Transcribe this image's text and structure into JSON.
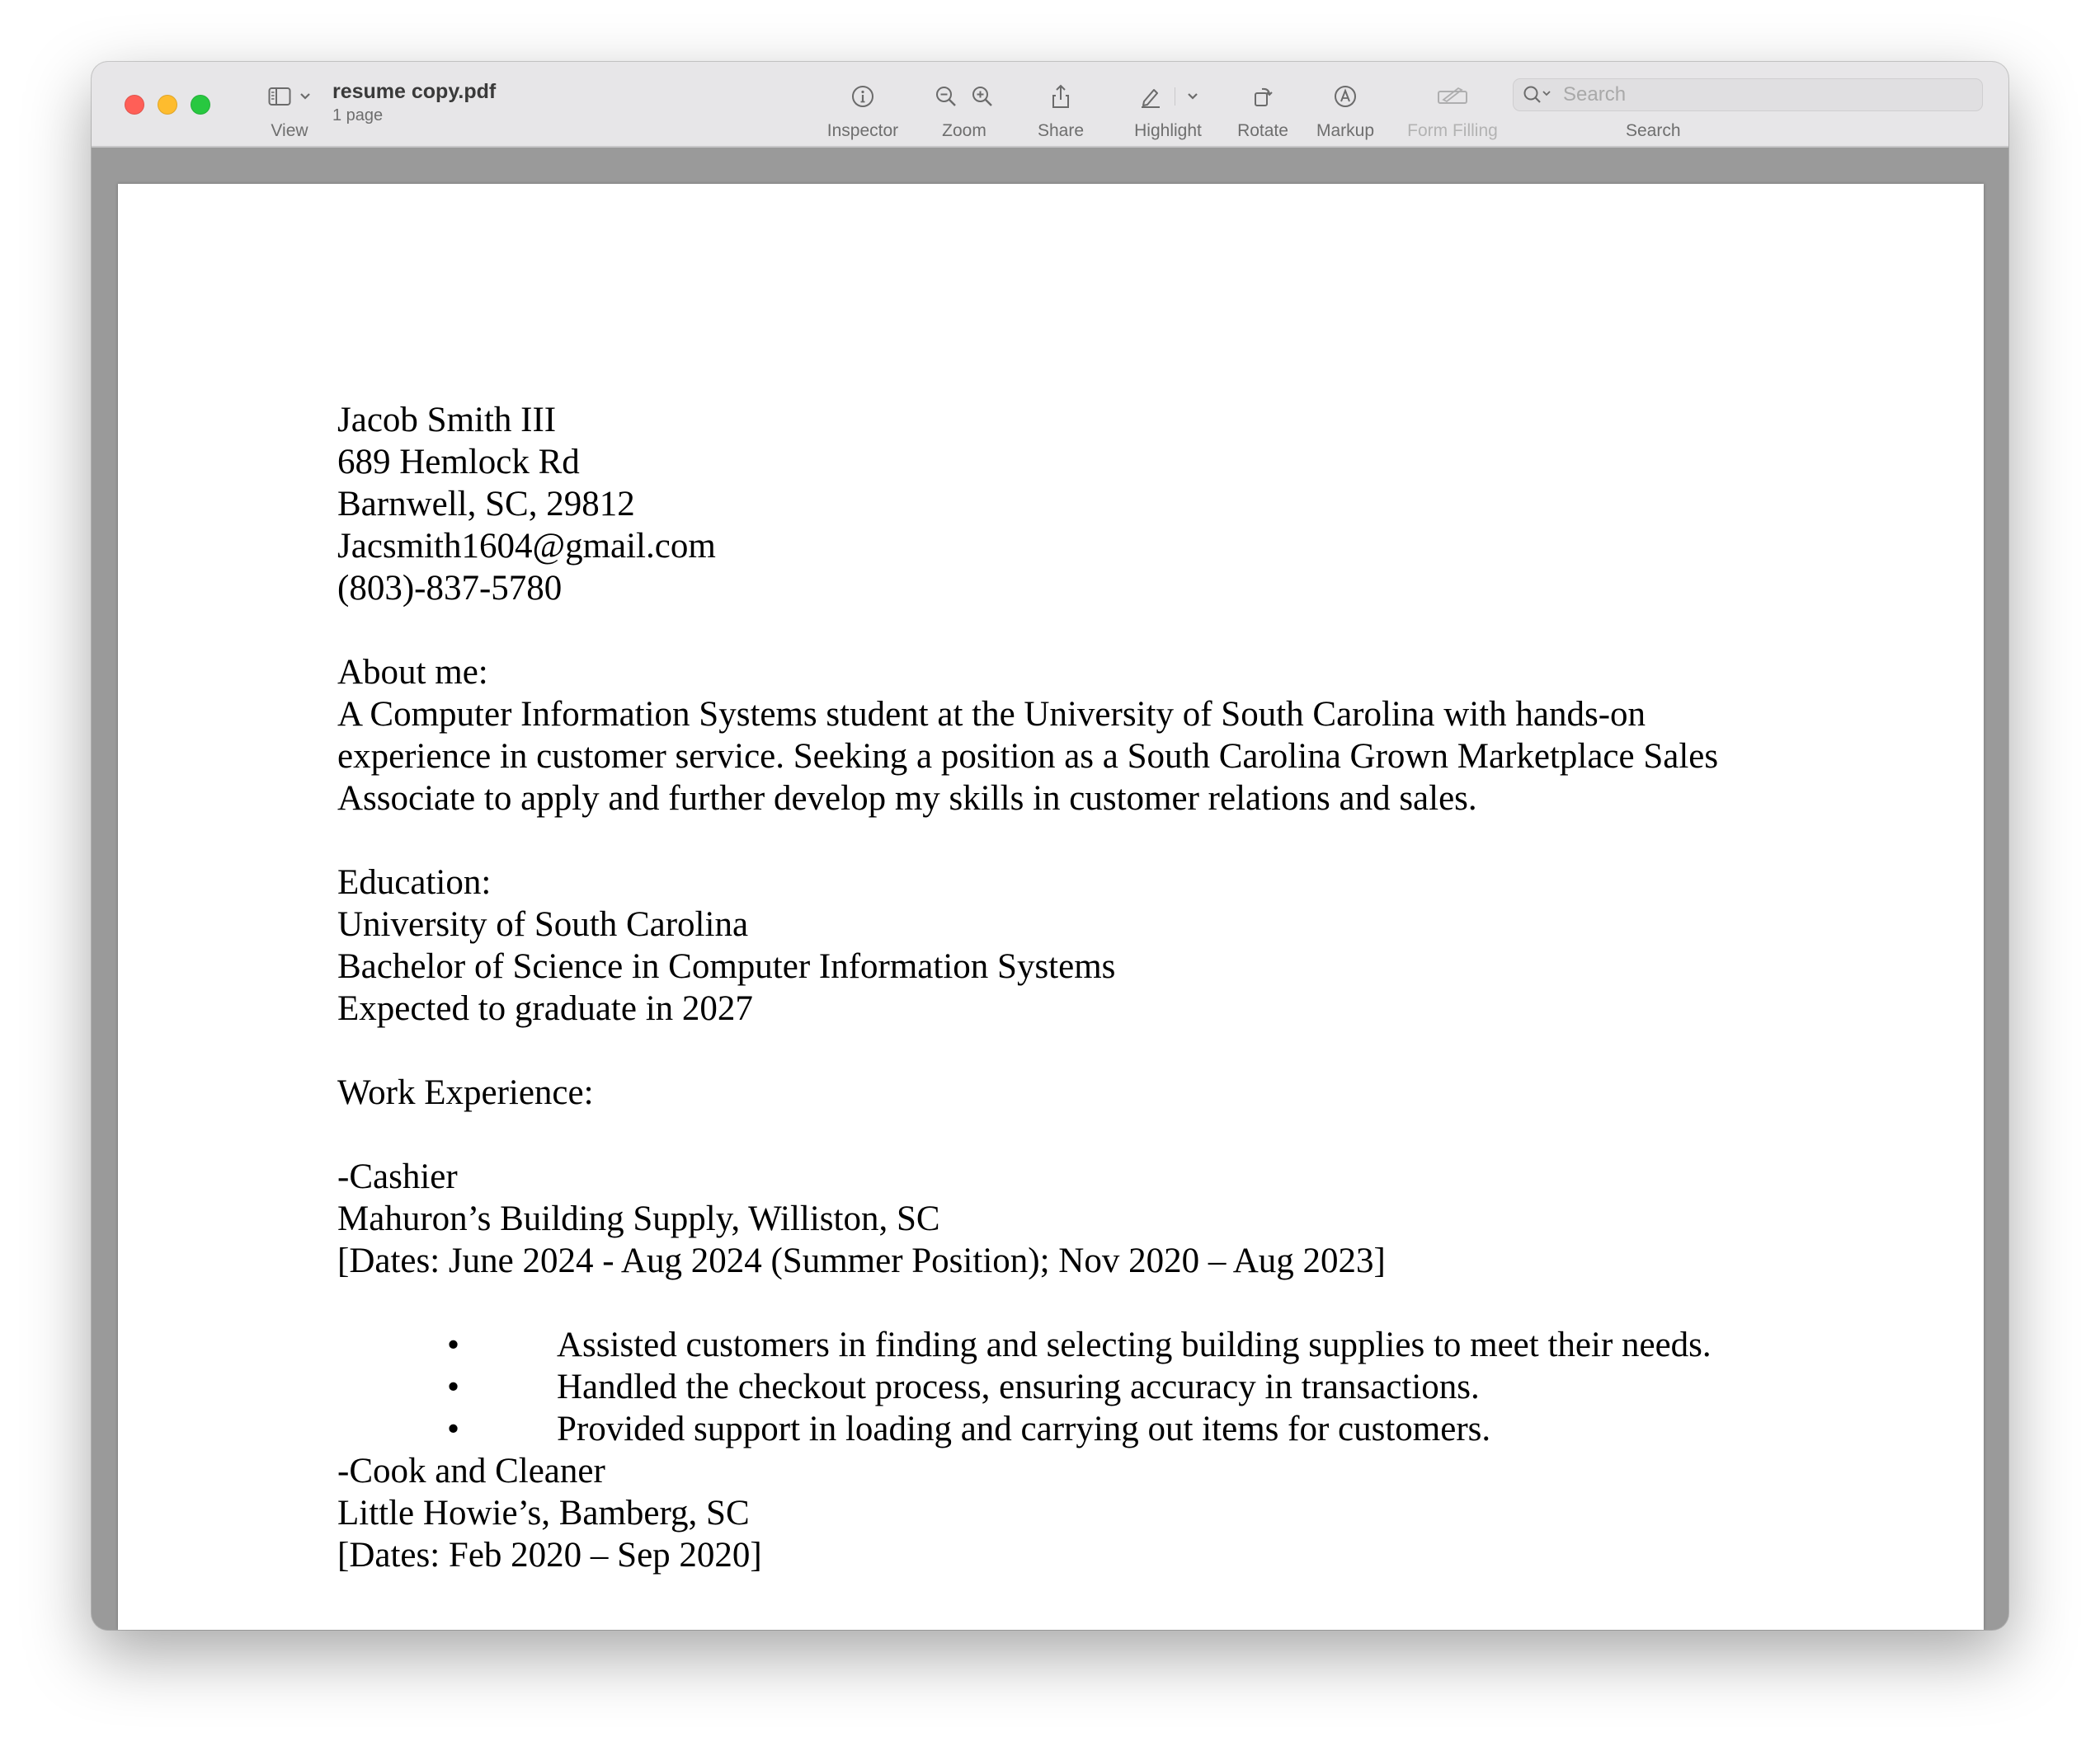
{
  "window": {
    "document_name": "resume copy.pdf",
    "page_count": "1 page"
  },
  "toolbar": {
    "view_label": "View",
    "inspector_label": "Inspector",
    "zoom_label": "Zoom",
    "share_label": "Share",
    "highlight_label": "Highlight",
    "rotate_label": "Rotate",
    "markup_label": "Markup",
    "form_filling_label": "Form Filling",
    "search_label": "Search",
    "search_placeholder": "Search",
    "search_value": ""
  },
  "resume": {
    "name": "Jacob Smith III",
    "address_line1": "689 Hemlock Rd",
    "address_line2": "Barnwell, SC, 29812",
    "email": "Jacsmith1604@gmail.com",
    "phone": "(803)-837-5780",
    "about_heading": "About me:",
    "about_lines": [
      "A Computer Information Systems student at the University of South Carolina with hands-on",
      "experience in customer service. Seeking a position as a South Carolina Grown Marketplace Sales",
      "Associate to apply and further develop my skills in customer relations and sales."
    ],
    "education_heading": "Education:",
    "education_school": "University of South Carolina",
    "education_degree": "Bachelor of Science in Computer Information Systems",
    "education_graduation": "Expected to graduate in 2027",
    "work_heading": "Work Experience:",
    "jobs": [
      {
        "title": "-Cashier",
        "employer": "Mahuron’s Building Supply, Williston, SC",
        "dates": "[Dates: June 2024 - Aug 2024 (Summer Position); Nov 2020 – Aug 2023]",
        "bullets": [
          "Assisted customers in finding and selecting building supplies to meet their needs.",
          "Handled the checkout process, ensuring accuracy in transactions.",
          "Provided support in loading and carrying out items for customers."
        ]
      },
      {
        "title": "-Cook and Cleaner",
        "employer": "Little Howie’s, Bamberg, SC",
        "dates": "[Dates: Feb 2020 – Sep 2020]"
      }
    ],
    "bullet_symbol": "•"
  },
  "icons": {
    "sidebar": "sidebar-icon",
    "inspector": "info-icon",
    "zoom_out": "zoom-out-icon",
    "zoom_in": "zoom-in-icon",
    "share": "share-icon",
    "highlight": "pen-icon",
    "rotate": "rotate-icon",
    "markup": "markup-icon",
    "form_filling": "form-icon",
    "search": "magnifier-icon"
  },
  "colors": {
    "close": "#ff5f57",
    "minimize": "#febc2e",
    "maximize": "#28c840",
    "toolbar_bg": "#e7e6e8",
    "canvas_bg": "#9a9a9a"
  }
}
